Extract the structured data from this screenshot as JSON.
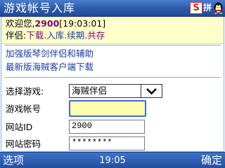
{
  "titlebar": {
    "title": "游戏帐号入库",
    "tray_s": "S",
    "tray_ime": "拼"
  },
  "welcome": {
    "prefix": "欢迎您,",
    "user_id": "2900",
    "time": "[19:03:01]",
    "companion_label": "伴侣:",
    "links": [
      "下载",
      "入库",
      "续期",
      "共存"
    ],
    "link_sep": "."
  },
  "menu": {
    "link1": "加强版琴剑伴侣和辅助",
    "link2": "最新版海贼客户端下载"
  },
  "form": {
    "game_label": "选择游戏:",
    "game_selected": "海贼伴侣",
    "account_label": "游戏帐号",
    "account_value": "",
    "site_id_label": "网站ID",
    "site_id_value": "2900",
    "site_pwd_label": "网站密码",
    "site_pwd_value": "********"
  },
  "softkeys": {
    "left": "选项",
    "time": "19:05",
    "right": "确定"
  },
  "colors": {
    "titlebar": "#2c5aa8",
    "welcome_bg": "#ffffcc",
    "highlight_purple": "#800080",
    "link_blue": "#1a3ca8",
    "focused_input_bg": "#ffffb0"
  }
}
